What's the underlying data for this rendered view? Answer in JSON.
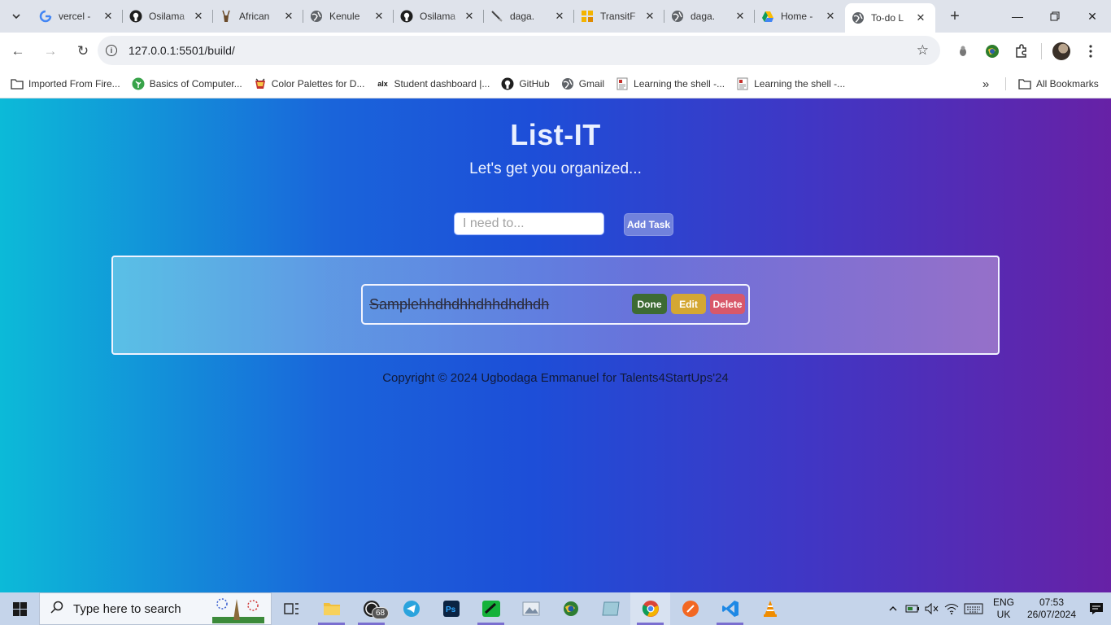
{
  "browser": {
    "tabs": [
      {
        "title": "vercel -",
        "icon": "google-icon"
      },
      {
        "title": "Osilama",
        "icon": "github-icon"
      },
      {
        "title": "African",
        "icon": "antelope-icon"
      },
      {
        "title": "Kenule",
        "icon": "globe-icon"
      },
      {
        "title": "Osilama",
        "icon": "github-icon"
      },
      {
        "title": "daga.",
        "icon": "pen-icon"
      },
      {
        "title": "TransitF",
        "icon": "grid-icon"
      },
      {
        "title": "daga.",
        "icon": "globe-icon"
      },
      {
        "title": "Home -",
        "icon": "drive-icon"
      },
      {
        "title": "To-do L",
        "icon": "globe-icon",
        "active": true
      }
    ],
    "new_tab": "+",
    "url": "127.0.0.1:5501/build/",
    "bookmarks": [
      {
        "label": "Imported From Fire...",
        "icon": "folder-icon"
      },
      {
        "label": "Basics of Computer...",
        "icon": "leaf-icon"
      },
      {
        "label": "Color Palettes for D...",
        "icon": "cup-icon"
      },
      {
        "label": "Student dashboard |...",
        "icon": "alx-icon"
      },
      {
        "label": "GitHub",
        "icon": "github-icon"
      },
      {
        "label": "Gmail",
        "icon": "globe-icon"
      },
      {
        "label": "Learning the shell -...",
        "icon": "page-icon"
      },
      {
        "label": "Learning the shell -...",
        "icon": "page-icon"
      }
    ],
    "more_bookmarks": "»",
    "all_bookmarks": "All Bookmarks"
  },
  "app": {
    "title": "List-IT",
    "subtitle": "Let's get you organized...",
    "input_placeholder": "I need to...",
    "add_button": "Add Task",
    "tasks": [
      {
        "text": "Samplehhdhdhhdhhdhdhdh",
        "completed": true,
        "done_label": "Done",
        "edit_label": "Edit",
        "delete_label": "Delete"
      }
    ],
    "footer": "Copyright © 2024 Ugbodaga Emmanuel for Talents4StartUps'24",
    "colors": {
      "gradient_start": "#0cbad8",
      "gradient_mid": "#1d4ed8",
      "gradient_end": "#6721a6",
      "done": "#3d6b33",
      "edit": "#d4a733",
      "delete": "#d8586a",
      "add": "#7182dc"
    }
  },
  "taskbar": {
    "search_placeholder": "Type here to search",
    "whatsapp_badge": "68",
    "lang_line1": "ENG",
    "lang_line2": "UK",
    "time": "07:53",
    "date": "26/07/2024"
  }
}
